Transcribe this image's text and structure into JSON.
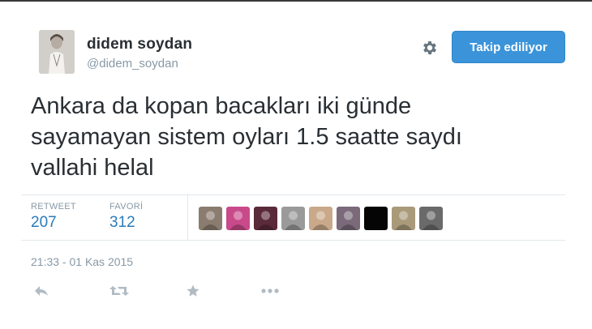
{
  "user": {
    "display_name": "didem soydan",
    "screen_name": "@didem_soydan"
  },
  "follow_button": {
    "label": "Takip ediliyor",
    "color": "#3b94d9"
  },
  "settings": {
    "icon": "gear-icon"
  },
  "tweet": {
    "text_lines": [
      "Ankara da kopan bacakları iki günde",
      "sayamayan sistem oyları 1.5 saatte saydı",
      "vallahi helal"
    ]
  },
  "stats": {
    "retweets": {
      "label": "RETWEET",
      "value": "207"
    },
    "favorites": {
      "label": "FAVORİ",
      "value": "312"
    }
  },
  "favoriters_avatars": [
    {
      "icon": "user-avatar-1",
      "color": "#8a7c6e"
    },
    {
      "icon": "user-avatar-2",
      "color": "#c94a8a"
    },
    {
      "icon": "user-avatar-3",
      "color": "#5a2a3a"
    },
    {
      "icon": "user-avatar-4",
      "color": "#9a9a9a"
    },
    {
      "icon": "user-avatar-5",
      "color": "#c9a98a"
    },
    {
      "icon": "user-avatar-6",
      "color": "#7a6a7a"
    },
    {
      "icon": "user-avatar-7",
      "color": "#050505"
    },
    {
      "icon": "user-avatar-8",
      "color": "#a99a7a"
    },
    {
      "icon": "user-avatar-9",
      "color": "#6a6a6a"
    }
  ],
  "timestamp": "21:33 - 01 Kas 2015",
  "actions": [
    {
      "name": "reply",
      "icon": "reply-icon"
    },
    {
      "name": "retweet",
      "icon": "retweet-icon"
    },
    {
      "name": "favorite",
      "icon": "star-icon"
    },
    {
      "name": "more",
      "icon": "more-dots-icon"
    }
  ]
}
